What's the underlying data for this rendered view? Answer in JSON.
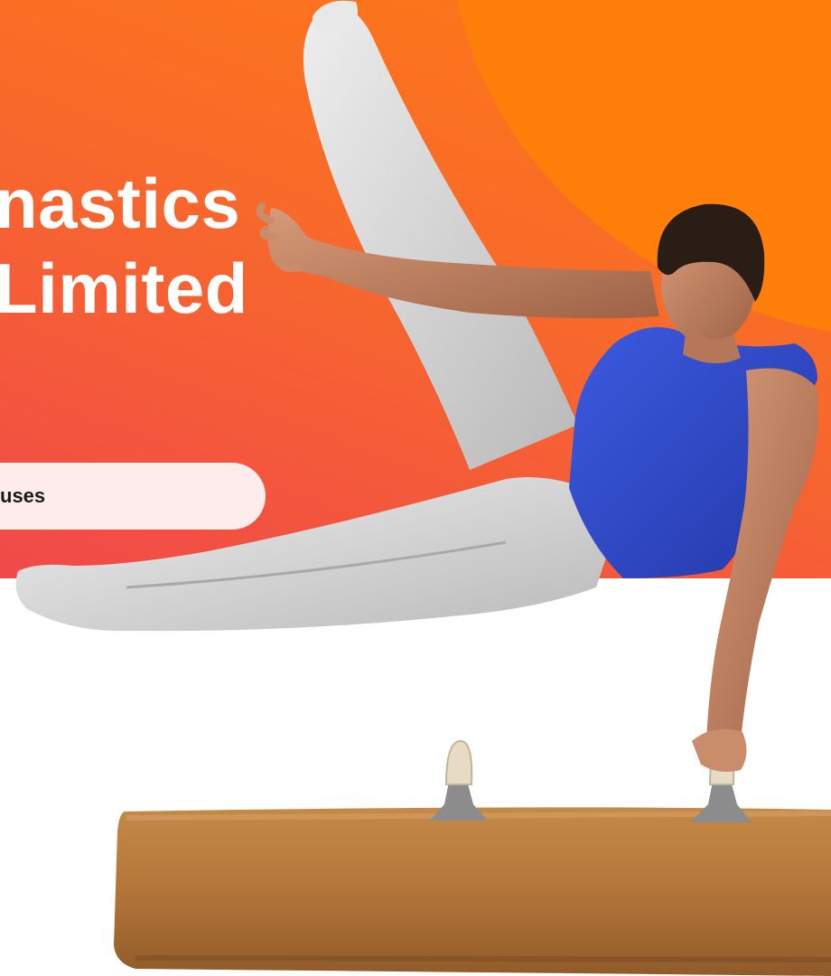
{
  "hero": {
    "title_line1": "nastics",
    "title_line2": "Limited",
    "cta_label": "uses"
  },
  "colors": {
    "hero_orange": "#ff7a12",
    "hero_red": "#f0494a",
    "button_bg": "#fdeceb",
    "singlet_blue": "#2f49c6",
    "tights_white": "#dcdcdc",
    "horse_leather": "#b47a3c"
  },
  "image": {
    "subject": "gymnast-pommel-horse-photo"
  }
}
